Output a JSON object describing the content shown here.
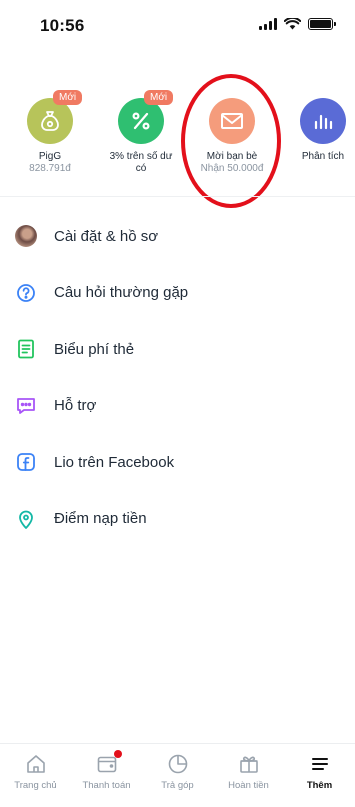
{
  "status_bar": {
    "time": "10:56"
  },
  "features": [
    {
      "label": "PigG",
      "sub": "828.791đ",
      "badge": "Mới",
      "color": "#b7c45a",
      "icon": "money-bag-icon"
    },
    {
      "label": "3% trên số dư có",
      "sub": "",
      "badge": "Mới",
      "color": "#2fbf71",
      "icon": "percent-icon"
    },
    {
      "label": "Mời bạn bè",
      "sub": "Nhận 50.000đ",
      "badge": "",
      "color": "#f59c7c",
      "icon": "envelope-icon"
    },
    {
      "label": "Phân tích",
      "sub": "",
      "badge": "",
      "color": "#5a6bd6",
      "icon": "bar-chart-icon"
    }
  ],
  "menu": [
    {
      "label": "Cài đặt & hồ sơ",
      "icon": "avatar"
    },
    {
      "label": "Câu hỏi thường gặp",
      "icon": "question-circle-icon",
      "color": "#3b82f6"
    },
    {
      "label": "Biểu phí thẻ",
      "icon": "document-icon",
      "color": "#22c55e"
    },
    {
      "label": "Hỗ trợ",
      "icon": "chat-bubble-icon",
      "color": "#a855f7"
    },
    {
      "label": "Lio trên Facebook",
      "icon": "facebook-icon",
      "color": "#3b82f6"
    },
    {
      "label": "Điểm nạp tiền",
      "icon": "location-pin-icon",
      "color": "#14b8a6"
    }
  ],
  "bottom_nav": [
    {
      "label": "Trang chủ",
      "icon": "home-icon"
    },
    {
      "label": "Thanh toán",
      "icon": "wallet-icon",
      "has_dot": true
    },
    {
      "label": "Trả góp",
      "icon": "pie-chart-icon"
    },
    {
      "label": "Hoàn tiền",
      "icon": "gift-icon"
    },
    {
      "label": "Thêm",
      "icon": "menu-icon",
      "active": true
    }
  ],
  "colors": {
    "highlight_ring": "#e3101b",
    "badge": "#f07a62",
    "text": "#1f2a37",
    "muted": "#8a94a0"
  }
}
